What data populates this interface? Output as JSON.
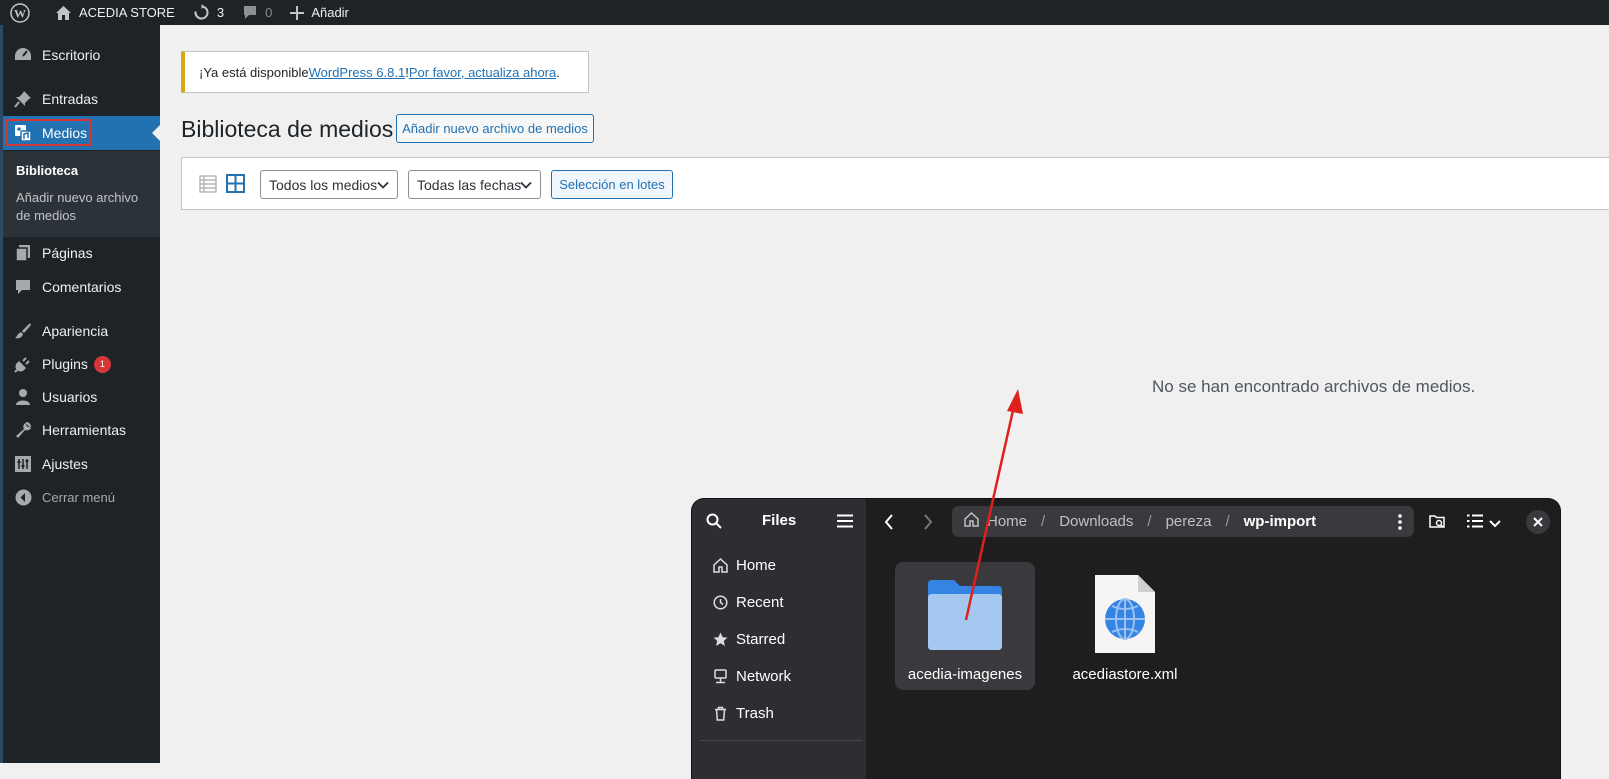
{
  "adminbar": {
    "site_name": "ACEDIA STORE",
    "updates_count": "3",
    "comments_count": "0",
    "new_label": "Añadir"
  },
  "sidebar": {
    "items": [
      {
        "label": "Escritorio",
        "icon": "dashboard-icon"
      },
      {
        "label": "Entradas",
        "icon": "pin-icon"
      },
      {
        "label": "Medios",
        "icon": "media-icon"
      },
      {
        "label": "Páginas",
        "icon": "pages-icon"
      },
      {
        "label": "Comentarios",
        "icon": "comment-icon"
      },
      {
        "label": "Apariencia",
        "icon": "brush-icon"
      },
      {
        "label": "Plugins",
        "icon": "plugin-icon",
        "badge": "1"
      },
      {
        "label": "Usuarios",
        "icon": "user-icon"
      },
      {
        "label": "Herramientas",
        "icon": "wrench-icon"
      },
      {
        "label": "Ajustes",
        "icon": "settings-icon"
      }
    ],
    "submenu": [
      "Biblioteca",
      "Añadir nuevo archivo de medios"
    ],
    "collapse_label": "Cerrar menú"
  },
  "notice": {
    "prefix": "¡Ya está disponible ",
    "link1": "WordPress 6.8.1",
    "middle": "! ",
    "link2": "Por favor, actualiza ahora",
    "suffix": "."
  },
  "main": {
    "title": "Biblioteca de medios",
    "add_new": "Añadir nuevo archivo de medios",
    "filter_type": "Todos los medios",
    "filter_date": "Todas las fechas",
    "bulk_select": "Selección en lotes",
    "empty_message": "No se han encontrado archivos de medios."
  },
  "files_window": {
    "title": "Files",
    "sidebar_items": [
      {
        "label": "Home",
        "icon": "home-icon"
      },
      {
        "label": "Recent",
        "icon": "clock-icon"
      },
      {
        "label": "Starred",
        "icon": "star-icon"
      },
      {
        "label": "Network",
        "icon": "network-icon"
      },
      {
        "label": "Trash",
        "icon": "trash-icon"
      }
    ],
    "path": [
      "Home",
      "Downloads",
      "pereza",
      "wp-import"
    ],
    "files": [
      {
        "name": "acedia-imagenes",
        "type": "folder"
      },
      {
        "name": "acediastore.xml",
        "type": "xml-file"
      }
    ]
  },
  "colors": {
    "wp_blue": "#2271b1",
    "sidebar_bg": "#1d2327",
    "highlight_red": "#d63638",
    "arrow_red": "#e0201b"
  }
}
